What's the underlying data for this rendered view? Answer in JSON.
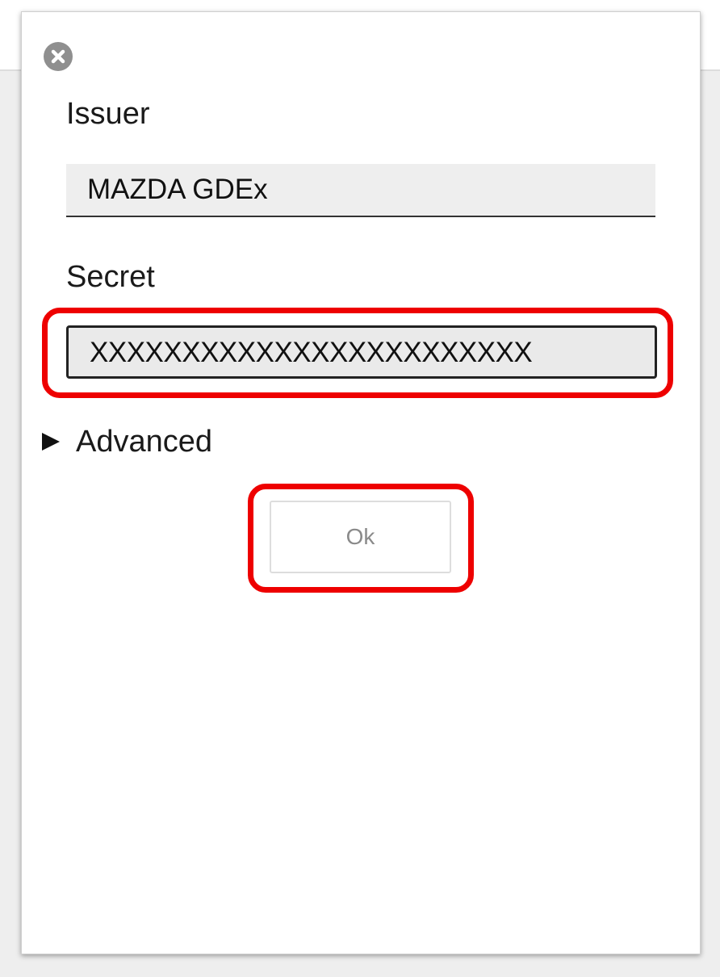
{
  "dialog": {
    "issuer_label": "Issuer",
    "issuer_value": "MAZDA GDEx",
    "secret_label": "Secret",
    "secret_value": "XXXXXXXXXXXXXXXXXXXXXXXX",
    "advanced_label": "Advanced",
    "ok_label": "Ok",
    "close_icon": "close-icon",
    "expand_icon": "triangle-right-icon"
  },
  "colors": {
    "highlight": "#ee0000",
    "field_background": "#eeeeee",
    "close_icon": "#8f8f8f",
    "ok_text": "#8a8a8a"
  }
}
